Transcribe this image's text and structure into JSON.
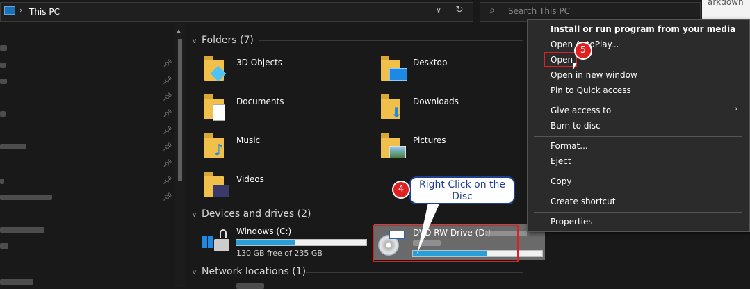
{
  "address": {
    "location": "This PC"
  },
  "search": {
    "placeholder": "Search This PC"
  },
  "background_text": "arkdown",
  "groups": {
    "folders": "Folders (7)",
    "devices": "Devices and drives (2)",
    "network": "Network locations (1)"
  },
  "folders": [
    {
      "name": "3D Objects",
      "icon": "3d-objects-icon"
    },
    {
      "name": "Desktop",
      "icon": "desktop-folder-icon"
    },
    {
      "name": "Documents",
      "icon": "documents-folder-icon"
    },
    {
      "name": "Downloads",
      "icon": "downloads-folder-icon"
    },
    {
      "name": "Music",
      "icon": "music-folder-icon"
    },
    {
      "name": "Pictures",
      "icon": "pictures-folder-icon"
    },
    {
      "name": "Videos",
      "icon": "videos-folder-icon"
    }
  ],
  "drives": [
    {
      "name": "Windows (C:)",
      "free": "130 GB free of 235 GB",
      "used_fraction": 0.45
    },
    {
      "name": "DVD RW Drive (D:)",
      "used_fraction": 0.57
    }
  ],
  "context_menu": {
    "items": [
      "Install or run program from your media",
      "Open AutoPlay...",
      "Open",
      "Open in new window",
      "Pin to Quick access",
      "Give access to",
      "Burn to disc",
      "Format...",
      "Eject",
      "Copy",
      "Create shortcut",
      "Properties"
    ]
  },
  "annotations": {
    "step4": "4",
    "step5": "5",
    "callout": "Right Click on the Disc"
  },
  "colors": {
    "accent": "#26a0da",
    "highlight_box": "#e02020",
    "callout_border": "#1f3f8f"
  }
}
